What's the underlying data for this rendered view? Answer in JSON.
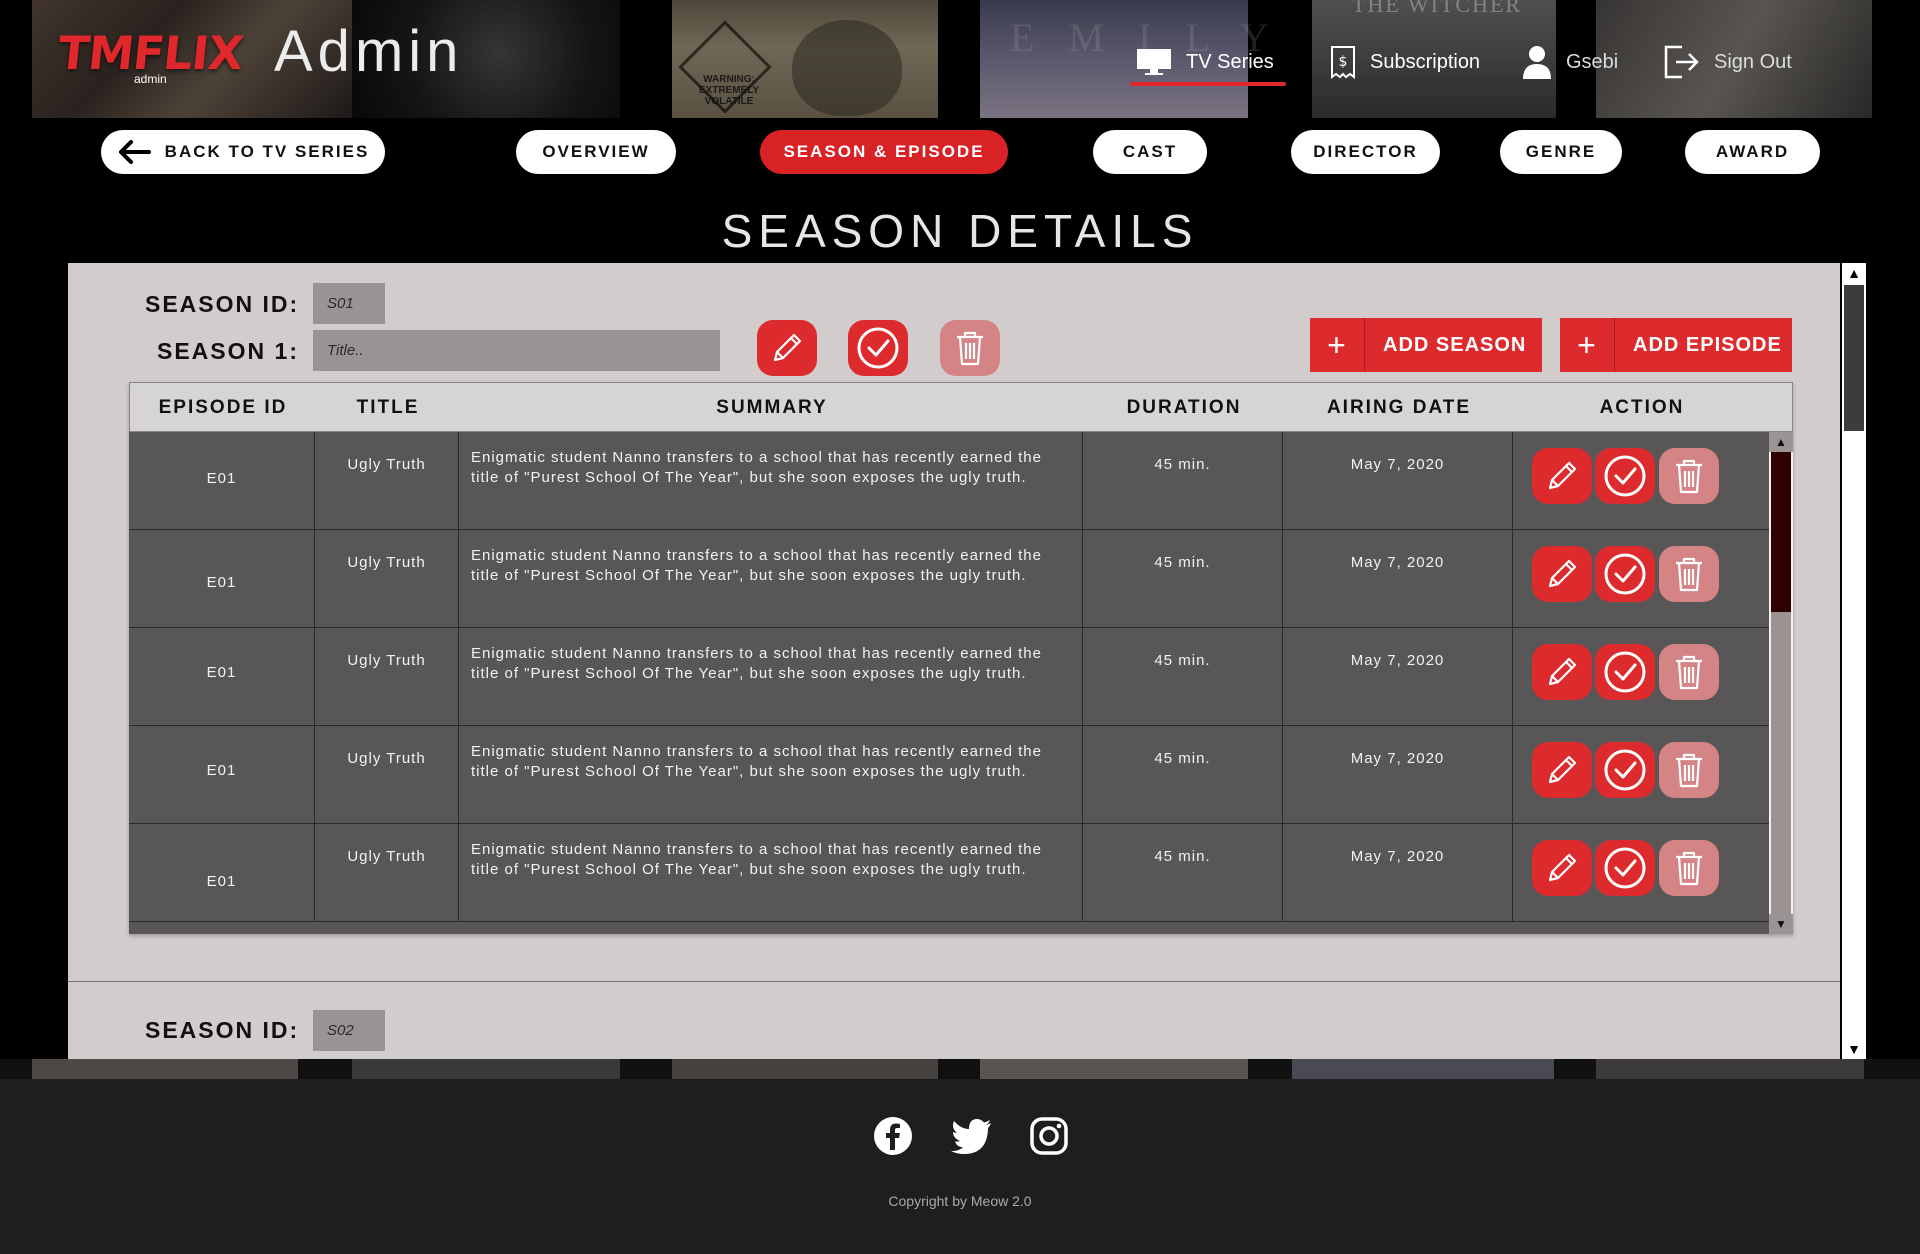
{
  "header": {
    "logo_text": "TMFLIX",
    "logo_sub": "admin",
    "title": "Admin",
    "nav": {
      "tv_series": "TV Series",
      "subscription": "Subscription",
      "user": "Gsebi",
      "sign_out": "Sign Out"
    },
    "poster_lettering": {
      "emily": "EMILY",
      "witcher": "THE WITCHER",
      "warning": "WARNING: EXTREMELY VOLATILE"
    }
  },
  "tabs": {
    "back": "BACK TO TV SERIES",
    "overview": "OVERVIEW",
    "season_episode": "SEASON & EPISODE",
    "cast": "CAST",
    "director": "DIRECTOR",
    "genre": "GENRE",
    "award": "AWARD",
    "active": "SEASON & EPISODE"
  },
  "section_title": "SEASON DETAILS",
  "season1": {
    "id_label": "SEASON ID:",
    "id_value": "S01",
    "name_label": "SEASON 1:",
    "title_placeholder": "Title.."
  },
  "actions": {
    "add_season": "ADD SEASON",
    "add_episode": "ADD EPISODE"
  },
  "table": {
    "columns": [
      "EPISODE ID",
      "TITLE",
      "SUMMARY",
      "DURATION",
      "AIRING DATE",
      "ACTION"
    ],
    "rows": [
      {
        "episode_id": "E01",
        "title": "Ugly Truth",
        "summary": "Enigmatic student Nanno transfers to a school that has recently earned the title of \"Purest School Of The Year\", but she soon exposes the ugly truth.",
        "duration": "45 min.",
        "airing_date": "May 7, 2020"
      },
      {
        "episode_id": "E01",
        "title": "Ugly Truth",
        "summary": "Enigmatic student Nanno transfers to a school that has recently earned the title of \"Purest School Of The Year\", but she soon exposes the ugly truth.",
        "duration": "45 min.",
        "airing_date": "May 7, 2020"
      },
      {
        "episode_id": "E01",
        "title": "Ugly Truth",
        "summary": "Enigmatic student Nanno transfers to a school that has recently earned the title of \"Purest School Of The Year\", but she soon exposes the ugly truth.",
        "duration": "45 min.",
        "airing_date": "May 7, 2020"
      },
      {
        "episode_id": "E01",
        "title": "Ugly Truth",
        "summary": "Enigmatic student Nanno transfers to a school that has recently earned the title of \"Purest School Of The Year\", but she soon exposes the ugly truth.",
        "duration": "45 min.",
        "airing_date": "May 7, 2020"
      },
      {
        "episode_id": "E01",
        "title": "Ugly Truth",
        "summary": "Enigmatic student Nanno transfers to a school that has recently earned the title of \"Purest School Of The Year\", but she soon exposes the ugly truth.",
        "duration": "45 min.",
        "airing_date": "May 7, 2020"
      }
    ]
  },
  "season2": {
    "id_label": "SEASON ID:",
    "id_value": "S02"
  },
  "footer": {
    "icons": [
      "facebook-icon",
      "twitter-icon",
      "instagram-icon"
    ],
    "copyright": "Copyright by Meow 2.0"
  },
  "colors": {
    "accent": "#dc2a2d",
    "accent_light": "#d58486",
    "panel_bg": "#d3cccd",
    "table_row_bg": "#595657"
  }
}
